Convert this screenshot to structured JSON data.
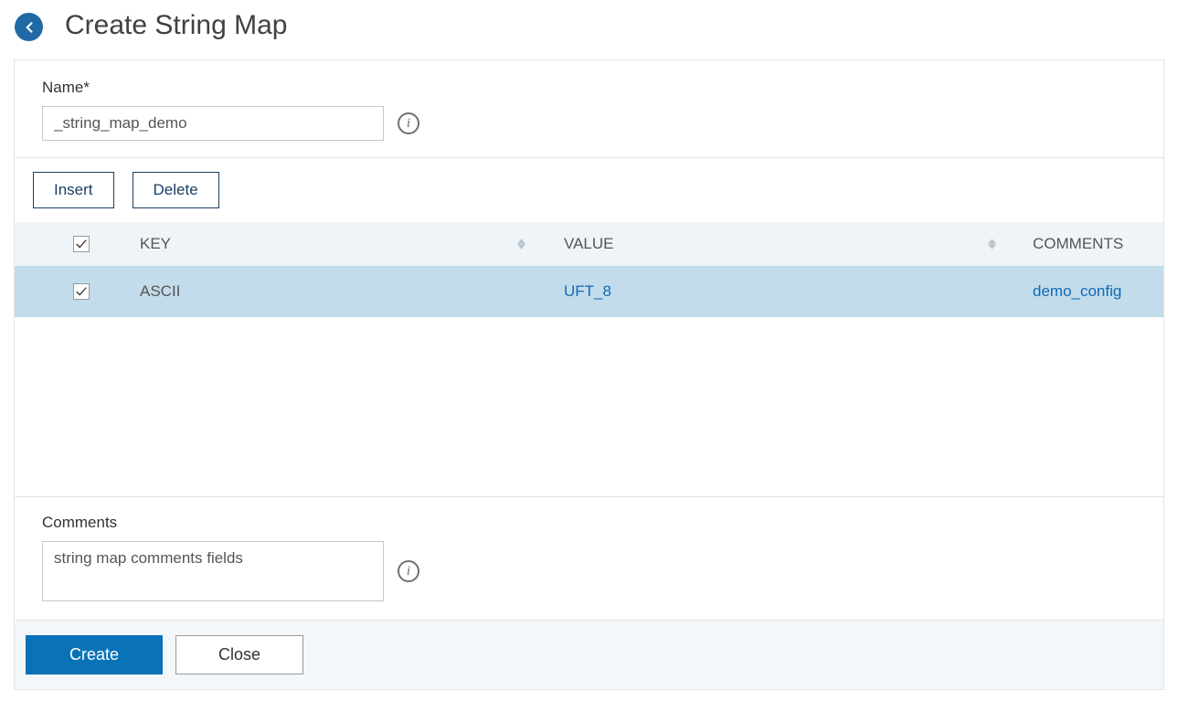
{
  "header": {
    "title": "Create String Map"
  },
  "form": {
    "name_label": "Name*",
    "name_value": "_string_map_demo",
    "comments_label": "Comments",
    "comments_value": "string map comments fields"
  },
  "table": {
    "actions": {
      "insert": "Insert",
      "delete": "Delete"
    },
    "columns": {
      "key": "KEY",
      "value": "VALUE",
      "comments": "COMMENTS"
    },
    "header_checked": true,
    "rows": [
      {
        "checked": true,
        "key": "ASCII",
        "value": "UFT_8",
        "comments": "demo_config"
      }
    ]
  },
  "footer": {
    "create": "Create",
    "close": "Close"
  }
}
